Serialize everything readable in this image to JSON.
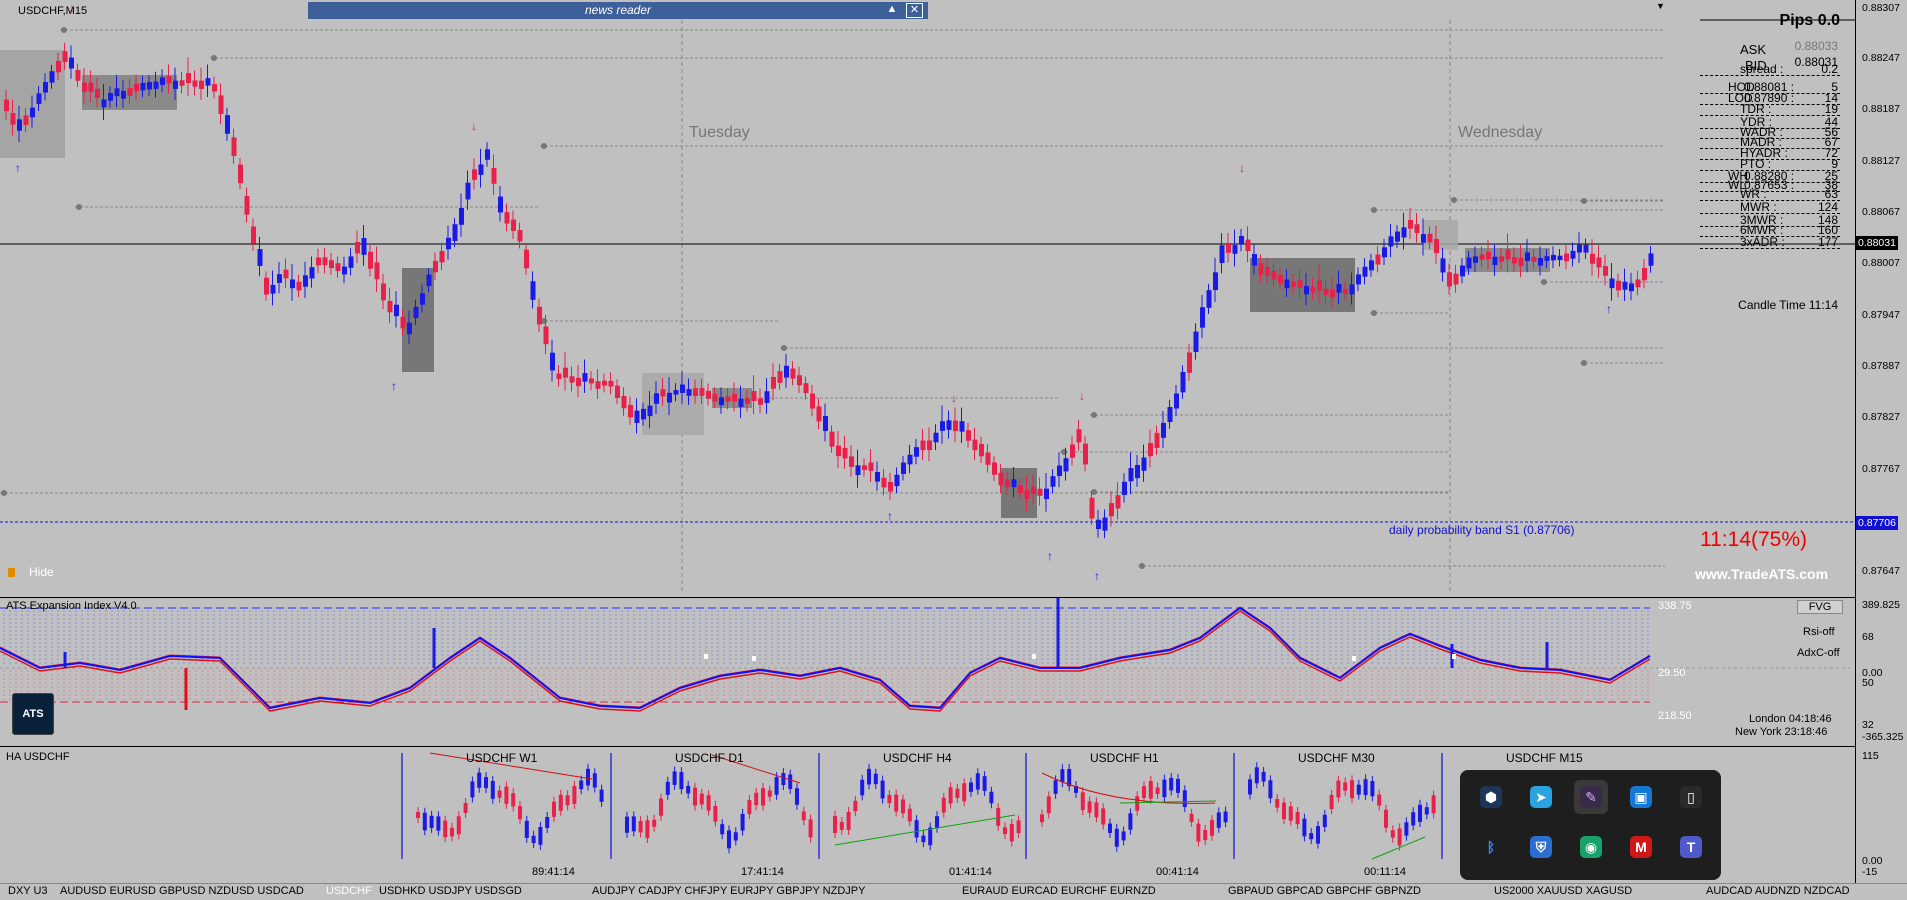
{
  "window": {
    "title": "USDCHF,M15"
  },
  "news_reader": {
    "title": "news reader",
    "collapse_icon": "triangle-up-icon",
    "close_icon": "close-icon"
  },
  "day_labels": [
    "Tuesday",
    "Wednesday"
  ],
  "price_axis": [
    "0.88307",
    "0.88247",
    "0.88187",
    "0.88127",
    "0.88067",
    "0.88007",
    "0.87947",
    "0.87887",
    "0.87827",
    "0.87767",
    "0.87647"
  ],
  "current_price": "0.88031",
  "band_price": "0.87706",
  "band_label": "daily probability band S1 (0.87706)",
  "hide_label": "Hide",
  "stats": {
    "pips": "Pips 0.0",
    "ask_label": "ASK",
    "ask": "0.88033",
    "bid_label": "BID",
    "bid": "0.88031",
    "rows": [
      {
        "label": "spread :",
        "value": "0.2"
      },
      {
        "label": "HOD",
        "mid": "0.88081 :",
        "value": "5"
      },
      {
        "label": "LOD",
        "mid": "0.87890 :",
        "value": "14"
      },
      {
        "label": "TDR :",
        "value": "19"
      },
      {
        "label": "YDR :",
        "value": "44"
      },
      {
        "label": "WADR :",
        "value": "56"
      },
      {
        "label": "MADR :",
        "value": "67"
      },
      {
        "label": "HYADR :",
        "value": "72"
      },
      {
        "label": "PTO :",
        "value": "9"
      },
      {
        "label": "WH",
        "mid": "0.88280 :",
        "value": "25"
      },
      {
        "label": "WL",
        "mid": "0.87653 :",
        "value": "38"
      },
      {
        "label": "WR :",
        "value": "63"
      },
      {
        "label": "MWR :",
        "value": "124"
      },
      {
        "label": "3MWR :",
        "value": "148"
      },
      {
        "label": "6MWR :",
        "value": "160"
      },
      {
        "label": "3xADR :",
        "value": "177"
      }
    ],
    "candle_time": "Candle Time 11:14",
    "countdown": "11:14(75%)",
    "website": "www.TradeATS.com"
  },
  "indicator": {
    "title": "ATS Expansion Index V4.0",
    "axis": [
      "389.825",
      "68",
      "0.00",
      "50",
      "32",
      "-365.325"
    ],
    "levels": [
      "338.75",
      "29.50",
      "218.50"
    ],
    "buttons": {
      "fvg": "FVG",
      "rsi": "Rsi-off",
      "adx": "AdxC-off"
    },
    "sessions": {
      "london": "London 04:18:46",
      "newyork": "New York 23:18:46"
    }
  },
  "ha_panel": {
    "title": "HA USDCHF",
    "axis": [
      "115",
      "0.00",
      "-15"
    ],
    "frames": [
      {
        "label": "USDCHF  W1",
        "timer": "89:41:14"
      },
      {
        "label": "USDCHF  D1",
        "timer": "17:41:14"
      },
      {
        "label": "USDCHF  H4",
        "timer": "01:41:14"
      },
      {
        "label": "USDCHF  H1",
        "timer": "00:41:14"
      },
      {
        "label": "USDCHF  M30",
        "timer": "00:11:14"
      },
      {
        "label": "USDCHF  M15",
        "timer": ""
      }
    ]
  },
  "symbols": [
    {
      "text": "DXY  U3",
      "active": false
    },
    {
      "text": "AUDUSD  EURUSD  GBPUSD  NZDUSD  USDCAD",
      "active": false
    },
    {
      "text": "USDCHF",
      "active": true
    },
    {
      "text": "USDHKD  USDJPY  USDSGD",
      "active": false
    },
    {
      "text": "AUDJPY  CADJPY  CHFJPY  EURJPY  GBPJPY  NZDJPY",
      "active": false
    },
    {
      "text": "EURAUD  EURCAD  EURCHF  EURNZD",
      "active": false
    },
    {
      "text": "GBPAUD  GBPCAD  GBPCHF  GBPNZD",
      "active": false
    },
    {
      "text": "US2000  XAUUSD  XAGUSD",
      "active": false
    },
    {
      "text": "AUDCAD  AUDNZD  NZDCAD",
      "active": false
    }
  ],
  "tray_icons": [
    "app-hex-icon",
    "telegram-icon",
    "feather-icon",
    "blue-window-icon",
    "usb-drive-icon",
    "bluetooth-icon",
    "defender-icon",
    "green-app-icon",
    "mcafee-icon",
    "teams-icon"
  ],
  "colors": {
    "bull": "#1a1ae6",
    "bear": "#e8204a",
    "bg": "#c0c0c0",
    "band": "#1010d0"
  }
}
